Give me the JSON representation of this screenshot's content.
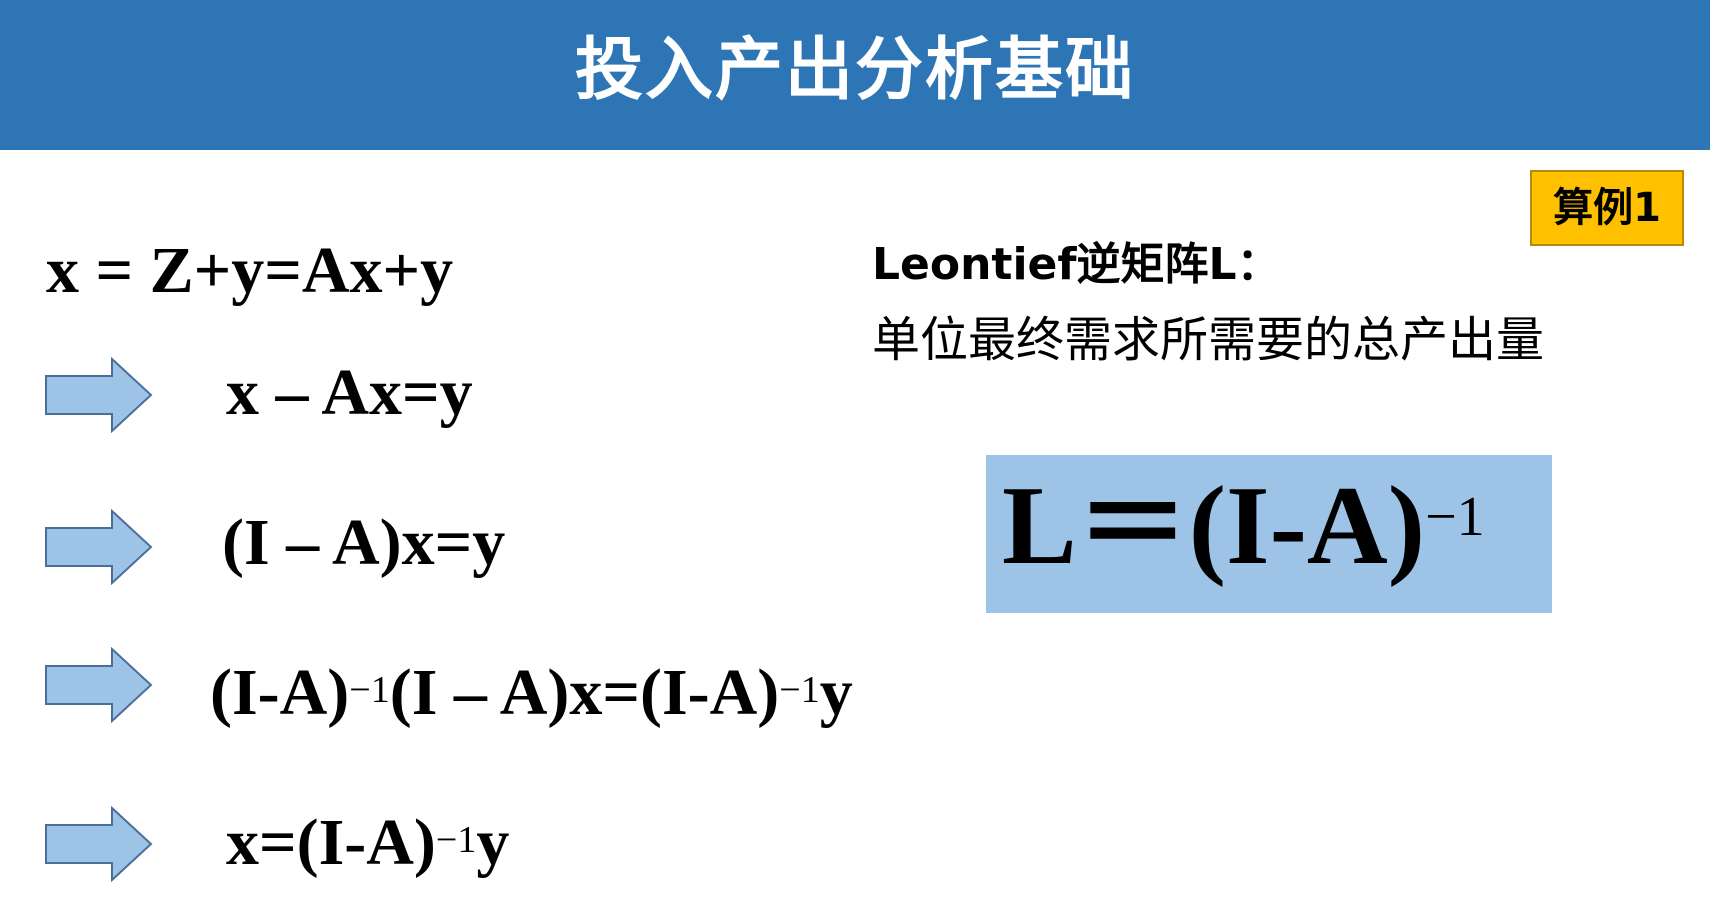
{
  "header": {
    "title": "投入产出分析基础"
  },
  "badge": {
    "label": "算例1"
  },
  "derivation": [
    {
      "text": "x = Z+y=Ax+y"
    },
    {
      "text": "x – Ax=y"
    },
    {
      "text": "(I – A)x=y"
    },
    {
      "base1": "(I-A)",
      "exp1": "−1",
      "mid": "(I – A)x=(I-A)",
      "exp2": "−1",
      "tail": "y"
    },
    {
      "base": "x=(I-A)",
      "exp": "−1",
      "tail": "y"
    }
  ],
  "leontief": {
    "title": "Leontief逆矩阵L：",
    "description": "单位最终需求所需要的总产出量",
    "formula_base": "L＝(I-A)",
    "formula_exp": "−1"
  },
  "colors": {
    "header": "#2E75B6",
    "badge": "#FFC000",
    "formula_box": "#9DC3E6",
    "arrow": "#9DC3E6"
  },
  "icons": [
    "right-arrow-icon"
  ]
}
